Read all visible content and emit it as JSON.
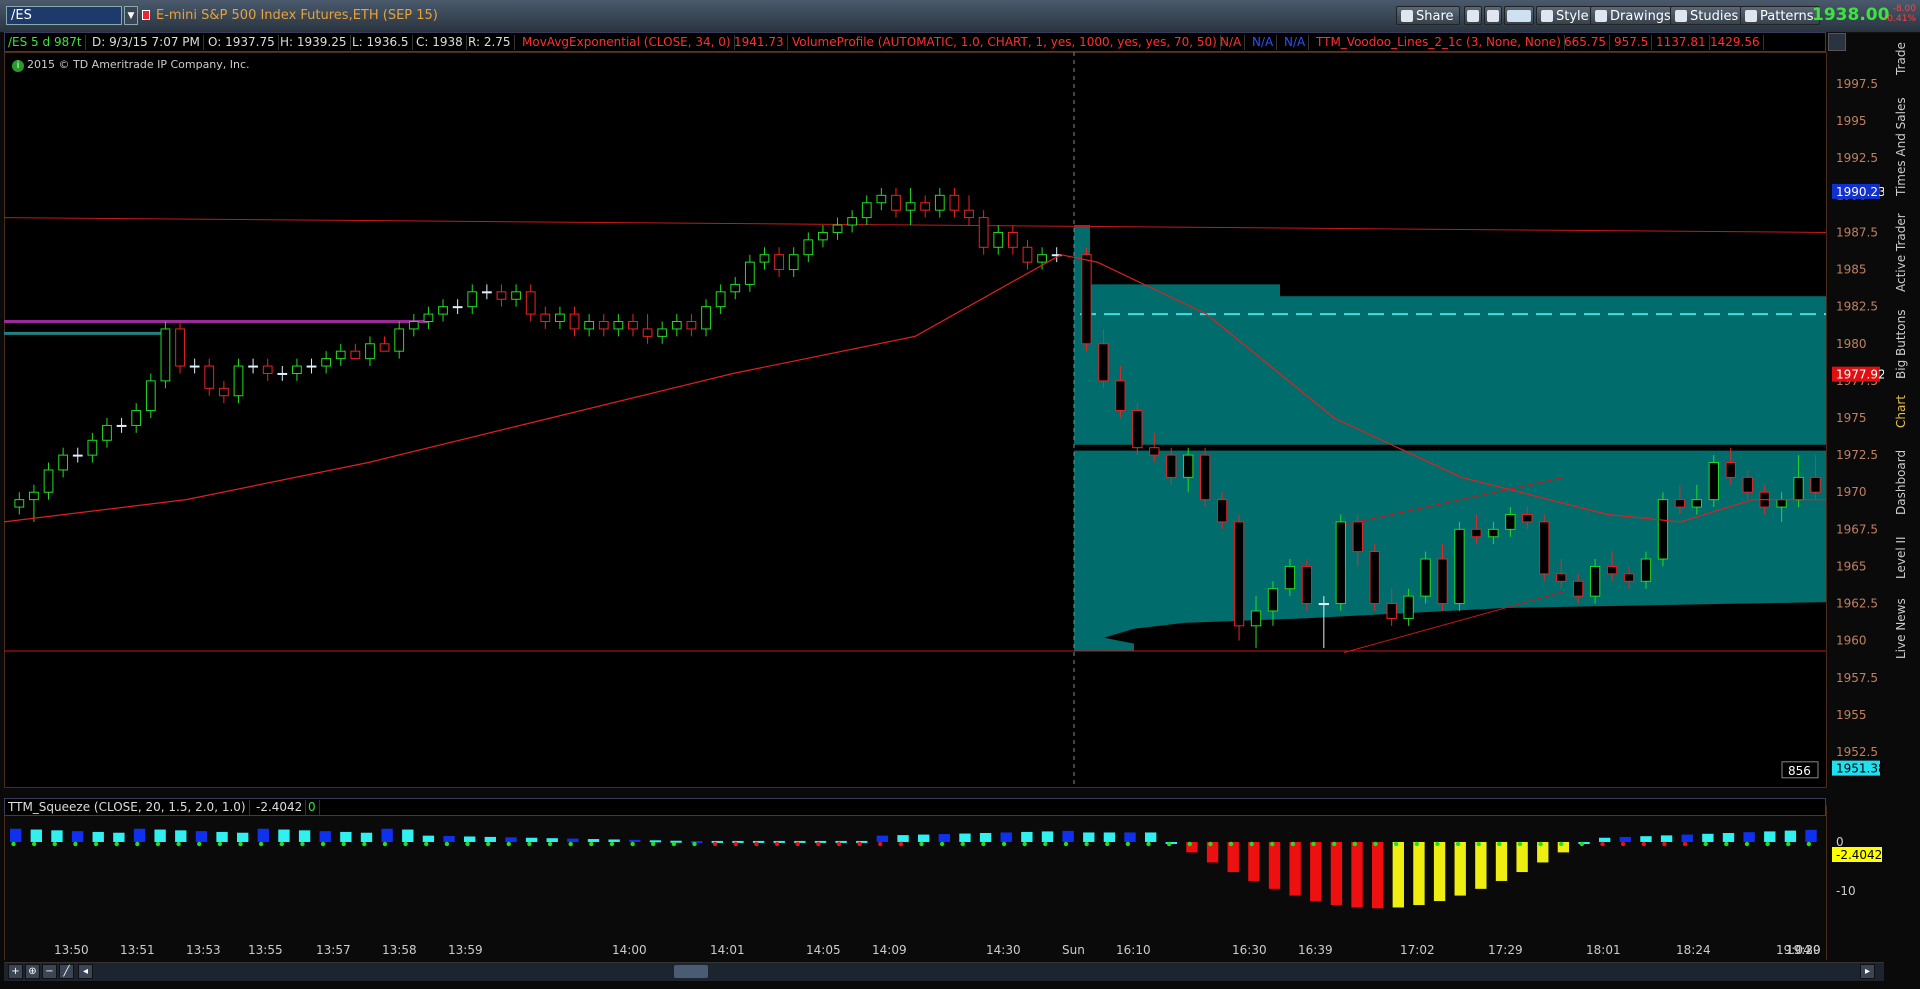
{
  "toolbar": {
    "symbol": "/ES",
    "description": "E-mini S&P 500 Index Futures,ETH (SEP 15)",
    "share_label": "Share",
    "style_label": "Style",
    "drawings_label": "Drawings",
    "studies_label": "Studies",
    "patterns_label": "Patterns",
    "last_price": "1938.00",
    "net_change": "-8.00",
    "pct_change": "-0.41%"
  },
  "colors": {
    "up": "#22dd22",
    "down": "#ee2222",
    "teal": "#007070",
    "ma": "#e02020"
  },
  "study_bar": {
    "symbol_period": "/ES 5 d 987t",
    "date": "D: 9/3/15 7:07 PM",
    "open": "O: 1937.75",
    "high": "H: 1939.25",
    "low": "L: 1936.5",
    "close": "C: 1938",
    "range": "R: 2.75",
    "ma_study": "MovAvgExponential (CLOSE, 34, 0)",
    "ma_value": "1941.73",
    "vp_study": "VolumeProfile (AUTOMATIC, 1.0, CHART, 1, yes, 1000, yes, yes, 70, 50)",
    "vp_na1": "N/A",
    "vp_na2": "N/A",
    "vp_na3": "N/A",
    "voodoo_study": "TTM_Voodoo_Lines_2_1c (3, None, None)",
    "voodoo_v1": "665.75",
    "voodoo_v2": "957.5",
    "voodoo_v3": "1137.81",
    "voodoo_v4": "1429.56"
  },
  "copyright": "2015 © TD Ameritrade IP Company, Inc.",
  "price_axis": {
    "ticks": [
      "1997.5",
      "1995",
      "1992.5",
      "1990",
      "1987.5",
      "1985",
      "1982.5",
      "1980",
      "1977.5",
      "1975",
      "1972.5",
      "1970",
      "1967.5",
      "1965",
      "1962.5",
      "1960",
      "1957.5",
      "1955",
      "1952.5"
    ],
    "badge_high": "1990.23",
    "badge_mid": "1977.92",
    "badge_low": "1951.38",
    "volume_label": "856"
  },
  "squeeze": {
    "label": "TTM_Squeeze (CLOSE, 20, 1.5, 2.0, 1.0)",
    "value": "-2.4042",
    "flag": "0",
    "axis_zero": "0",
    "axis_minus10": "-10",
    "badge": "-2.4042"
  },
  "time_axis": [
    "13:50",
    "13:51",
    "13:53",
    "13:55",
    "13:57",
    "13:58",
    "13:59",
    "14:00",
    "14:01",
    "14:05",
    "14:09",
    "14:30",
    "Sun",
    "16:10",
    "16:30",
    "16:39",
    "17:02",
    "17:29",
    "18:01",
    "18:24",
    "19:04",
    "19:20",
    "19:39"
  ],
  "side_tabs": [
    "Trade",
    "Times And Sales",
    "Active Trader",
    "Big Buttons",
    "Chart",
    "Dashboard",
    "Level II",
    "Live News"
  ],
  "chart_data": {
    "type": "candlestick",
    "y_range": [
      1951.38,
      1999.5
    ],
    "candles_pre": [
      [
        1969.0,
        1970.0,
        1968.5,
        1969.5
      ],
      [
        1969.5,
        1970.5,
        1968.0,
        1970.0
      ],
      [
        1970.0,
        1972.0,
        1969.5,
        1971.5
      ],
      [
        1971.5,
        1973.0,
        1971.0,
        1972.5
      ],
      [
        1972.5,
        1973.0,
        1972.0,
        1972.5
      ],
      [
        1972.5,
        1974.0,
        1972.0,
        1973.5
      ],
      [
        1973.5,
        1975.0,
        1973.0,
        1974.5
      ],
      [
        1974.5,
        1975.0,
        1974.0,
        1974.5
      ],
      [
        1974.5,
        1976.0,
        1974.0,
        1975.5
      ],
      [
        1975.5,
        1978.0,
        1975.0,
        1977.5
      ],
      [
        1977.5,
        1981.5,
        1977.0,
        1981.0
      ],
      [
        1981.0,
        1981.5,
        1978.0,
        1978.5
      ],
      [
        1978.5,
        1979.0,
        1978.0,
        1978.5
      ],
      [
        1978.5,
        1979.0,
        1976.5,
        1977.0
      ],
      [
        1977.0,
        1977.5,
        1976.0,
        1976.5
      ],
      [
        1976.5,
        1979.0,
        1976.0,
        1978.5
      ],
      [
        1978.5,
        1979.0,
        1978.0,
        1978.5
      ],
      [
        1978.5,
        1979.0,
        1977.5,
        1978.0
      ],
      [
        1978.0,
        1978.5,
        1977.5,
        1978.0
      ],
      [
        1978.0,
        1979.0,
        1977.5,
        1978.5
      ],
      [
        1978.5,
        1979.0,
        1978.0,
        1978.5
      ],
      [
        1978.5,
        1979.5,
        1978.0,
        1979.0
      ],
      [
        1979.0,
        1980.0,
        1978.5,
        1979.5
      ],
      [
        1979.5,
        1980.0,
        1979.0,
        1979.0
      ],
      [
        1979.0,
        1980.5,
        1978.5,
        1980.0
      ],
      [
        1980.0,
        1980.5,
        1979.5,
        1979.5
      ],
      [
        1979.5,
        1981.5,
        1979.0,
        1981.0
      ],
      [
        1981.0,
        1982.0,
        1980.5,
        1981.5
      ],
      [
        1981.5,
        1982.5,
        1981.0,
        1982.0
      ],
      [
        1982.0,
        1983.0,
        1981.5,
        1982.5
      ],
      [
        1982.5,
        1983.0,
        1982.0,
        1982.5
      ],
      [
        1982.5,
        1984.0,
        1982.0,
        1983.5
      ],
      [
        1983.5,
        1984.0,
        1983.0,
        1983.5
      ],
      [
        1983.5,
        1984.0,
        1982.5,
        1983.0
      ],
      [
        1983.0,
        1984.0,
        1982.5,
        1983.5
      ],
      [
        1983.5,
        1984.0,
        1981.5,
        1982.0
      ],
      [
        1982.0,
        1982.5,
        1981.0,
        1981.5
      ],
      [
        1981.5,
        1982.5,
        1981.0,
        1982.0
      ],
      [
        1982.0,
        1982.5,
        1980.5,
        1981.0
      ],
      [
        1981.0,
        1982.0,
        1980.5,
        1981.5
      ],
      [
        1981.5,
        1982.0,
        1980.5,
        1981.0
      ],
      [
        1981.0,
        1982.0,
        1980.5,
        1981.5
      ],
      [
        1981.5,
        1982.0,
        1980.5,
        1981.0
      ],
      [
        1981.0,
        1982.0,
        1980.0,
        1980.5
      ],
      [
        1980.5,
        1981.5,
        1980.0,
        1981.0
      ],
      [
        1981.0,
        1982.0,
        1980.5,
        1981.5
      ],
      [
        1981.5,
        1982.0,
        1980.5,
        1981.0
      ],
      [
        1981.0,
        1983.0,
        1980.5,
        1982.5
      ],
      [
        1982.5,
        1984.0,
        1982.0,
        1983.5
      ],
      [
        1983.5,
        1984.5,
        1983.0,
        1984.0
      ],
      [
        1984.0,
        1986.0,
        1983.5,
        1985.5
      ],
      [
        1985.5,
        1986.5,
        1985.0,
        1986.0
      ],
      [
        1986.0,
        1986.5,
        1984.5,
        1985.0
      ],
      [
        1985.0,
        1986.5,
        1984.5,
        1986.0
      ],
      [
        1986.0,
        1987.5,
        1985.5,
        1987.0
      ],
      [
        1987.0,
        1988.0,
        1986.5,
        1987.5
      ],
      [
        1987.5,
        1988.5,
        1987.0,
        1988.0
      ],
      [
        1988.0,
        1989.0,
        1987.5,
        1988.5
      ],
      [
        1988.5,
        1990.0,
        1988.0,
        1989.5
      ],
      [
        1989.5,
        1990.5,
        1989.0,
        1990.0
      ],
      [
        1990.0,
        1990.5,
        1988.5,
        1989.0
      ],
      [
        1989.0,
        1990.5,
        1988.0,
        1989.5
      ],
      [
        1989.5,
        1990.0,
        1988.5,
        1989.0
      ],
      [
        1989.0,
        1990.5,
        1988.5,
        1990.0
      ],
      [
        1990.0,
        1990.5,
        1988.5,
        1989.0
      ],
      [
        1989.0,
        1990.0,
        1988.0,
        1988.5
      ],
      [
        1988.5,
        1989.0,
        1986.0,
        1986.5
      ],
      [
        1986.5,
        1988.0,
        1986.0,
        1987.5
      ],
      [
        1987.5,
        1988.0,
        1986.0,
        1986.5
      ],
      [
        1986.5,
        1987.0,
        1985.0,
        1985.5
      ],
      [
        1985.5,
        1986.5,
        1985.0,
        1986.0
      ],
      [
        1986.0,
        1986.5,
        1985.5,
        1986.0
      ]
    ],
    "candles_post": [
      [
        1986.0,
        1986.5,
        1979.5,
        1980.0
      ],
      [
        1980.0,
        1981.0,
        1977.0,
        1977.5
      ],
      [
        1977.5,
        1978.5,
        1975.0,
        1975.5
      ],
      [
        1975.5,
        1976.0,
        1972.5,
        1973.0
      ],
      [
        1973.0,
        1974.0,
        1972.0,
        1972.5
      ],
      [
        1972.5,
        1973.0,
        1970.5,
        1971.0
      ],
      [
        1971.0,
        1973.0,
        1970.0,
        1972.5
      ],
      [
        1972.5,
        1973.0,
        1969.0,
        1969.5
      ],
      [
        1969.5,
        1970.0,
        1967.5,
        1968.0
      ],
      [
        1968.0,
        1968.5,
        1960.0,
        1961.0
      ],
      [
        1961.0,
        1963.0,
        1959.5,
        1962.0
      ],
      [
        1962.0,
        1964.0,
        1961.0,
        1963.5
      ],
      [
        1963.5,
        1965.5,
        1963.0,
        1965.0
      ],
      [
        1965.0,
        1965.5,
        1962.0,
        1962.5
      ],
      [
        1962.5,
        1963.0,
        1959.5,
        1962.5
      ],
      [
        1962.5,
        1968.5,
        1962.0,
        1968.0
      ],
      [
        1968.0,
        1968.5,
        1965.0,
        1966.0
      ],
      [
        1966.0,
        1966.5,
        1962.0,
        1962.5
      ],
      [
        1962.5,
        1963.5,
        1961.0,
        1961.5
      ],
      [
        1961.5,
        1963.5,
        1961.0,
        1963.0
      ],
      [
        1963.0,
        1966.0,
        1962.5,
        1965.5
      ],
      [
        1965.5,
        1966.5,
        1962.0,
        1962.5
      ],
      [
        1962.5,
        1968.0,
        1962.0,
        1967.5
      ],
      [
        1967.5,
        1968.5,
        1966.5,
        1967.0
      ],
      [
        1967.0,
        1968.0,
        1966.5,
        1967.5
      ],
      [
        1967.5,
        1969.0,
        1967.0,
        1968.5
      ],
      [
        1968.5,
        1969.0,
        1967.5,
        1968.0
      ],
      [
        1968.0,
        1968.5,
        1964.0,
        1964.5
      ],
      [
        1964.5,
        1965.5,
        1963.5,
        1964.0
      ],
      [
        1964.0,
        1964.5,
        1962.5,
        1963.0
      ],
      [
        1963.0,
        1965.5,
        1962.5,
        1965.0
      ],
      [
        1965.0,
        1966.0,
        1964.0,
        1964.5
      ],
      [
        1964.5,
        1965.0,
        1963.5,
        1964.0
      ],
      [
        1964.0,
        1966.0,
        1963.5,
        1965.5
      ],
      [
        1965.5,
        1970.0,
        1965.0,
        1969.5
      ],
      [
        1969.5,
        1970.5,
        1968.5,
        1969.0
      ],
      [
        1969.0,
        1970.5,
        1968.5,
        1969.5
      ],
      [
        1969.5,
        1972.5,
        1969.0,
        1972.0
      ],
      [
        1972.0,
        1973.0,
        1970.5,
        1971.0
      ],
      [
        1971.0,
        1971.5,
        1969.5,
        1970.0
      ],
      [
        1970.0,
        1970.5,
        1968.5,
        1969.0
      ],
      [
        1969.0,
        1970.0,
        1968.0,
        1969.5
      ],
      [
        1969.5,
        1972.5,
        1969.0,
        1971.0
      ],
      [
        1971.0,
        1972.5,
        1969.5,
        1970.0
      ]
    ],
    "ema_points": [
      [
        0,
        1968.0
      ],
      [
        0.1,
        1969.5
      ],
      [
        0.2,
        1972.0
      ],
      [
        0.3,
        1975.0
      ],
      [
        0.4,
        1978.0
      ],
      [
        0.5,
        1980.5
      ],
      [
        0.58,
        1986.0
      ],
      [
        0.6,
        1985.5
      ],
      [
        0.66,
        1982.0
      ],
      [
        0.73,
        1975.0
      ],
      [
        0.8,
        1971.0
      ],
      [
        0.88,
        1968.5
      ],
      [
        0.92,
        1968.0
      ],
      [
        0.96,
        1969.5
      ],
      [
        1,
        1969.5
      ]
    ]
  }
}
